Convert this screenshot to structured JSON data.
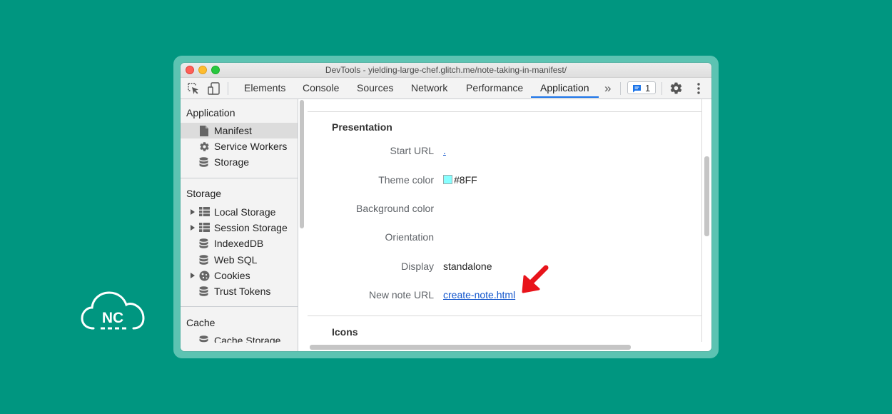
{
  "window": {
    "title": "DevTools - yielding-large-chef.glitch.me/note-taking-in-manifest/"
  },
  "toolbar": {
    "tabs": [
      "Elements",
      "Console",
      "Sources",
      "Network",
      "Performance",
      "Application"
    ],
    "active_tab": "Application",
    "more_tabs": "»",
    "issues_count": "1"
  },
  "sidebar": {
    "application_title": "Application",
    "application_items": [
      "Manifest",
      "Service Workers",
      "Storage"
    ],
    "storage_title": "Storage",
    "storage_items": [
      "Local Storage",
      "Session Storage",
      "IndexedDB",
      "Web SQL",
      "Cookies",
      "Trust Tokens"
    ],
    "cache_title": "Cache",
    "cache_items": [
      "Cache Storage"
    ]
  },
  "manifest": {
    "presentation_title": "Presentation",
    "start_url_label": "Start URL",
    "start_url_value": ".",
    "theme_color_label": "Theme color",
    "theme_color_value": "#8FF",
    "background_color_label": "Background color",
    "orientation_label": "Orientation",
    "display_label": "Display",
    "display_value": "standalone",
    "new_note_url_label": "New note URL",
    "new_note_url_value": "create-note.html",
    "icons_title": "Icons"
  },
  "logo": {
    "text": "NC"
  },
  "colors": {
    "background": "#009680",
    "accent": "#1a73e8",
    "arrow": "#e8141b",
    "swatch": "#88ffff"
  }
}
